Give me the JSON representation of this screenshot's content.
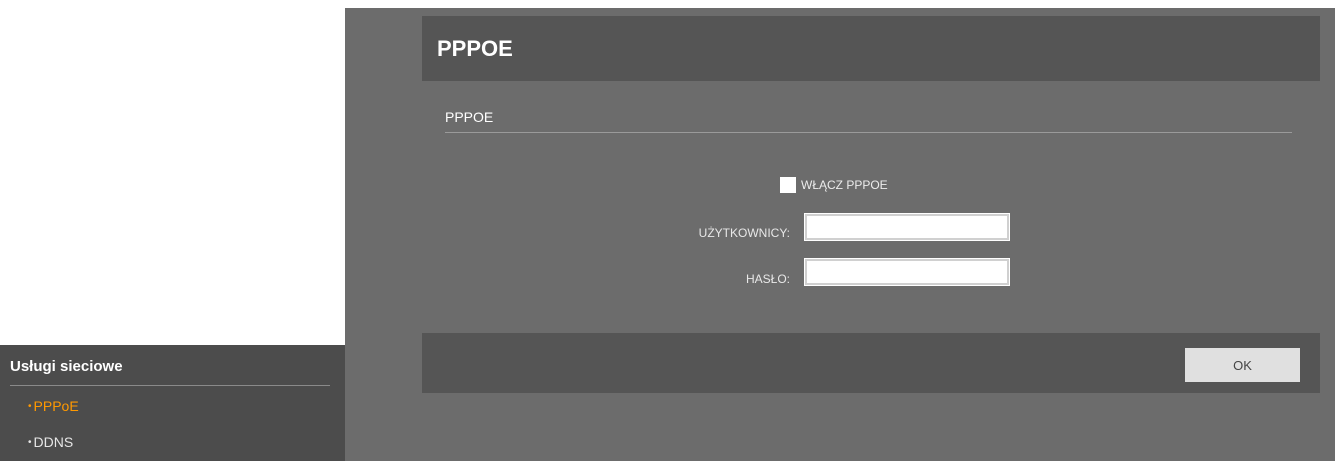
{
  "sidebar": {
    "title": "Usługi sieciowe",
    "items": [
      {
        "label": "PPPoE",
        "active": true
      },
      {
        "label": "DDNS",
        "active": false
      }
    ],
    "bullet": "•"
  },
  "header": {
    "title": "PPPOE"
  },
  "section": {
    "title": "PPPOE"
  },
  "form": {
    "enable_label": "WŁĄCZ PPPOE",
    "enable_checked": false,
    "user_label": "UŻYTKOWNICY:",
    "user_value": "",
    "password_label": "HASŁO:",
    "password_value": ""
  },
  "footer": {
    "ok_label": "OK"
  },
  "colors": {
    "accent": "#ff9900",
    "panel": "#6c6c6c",
    "header_bar": "#555555",
    "sidebar": "#4c4c4c"
  }
}
